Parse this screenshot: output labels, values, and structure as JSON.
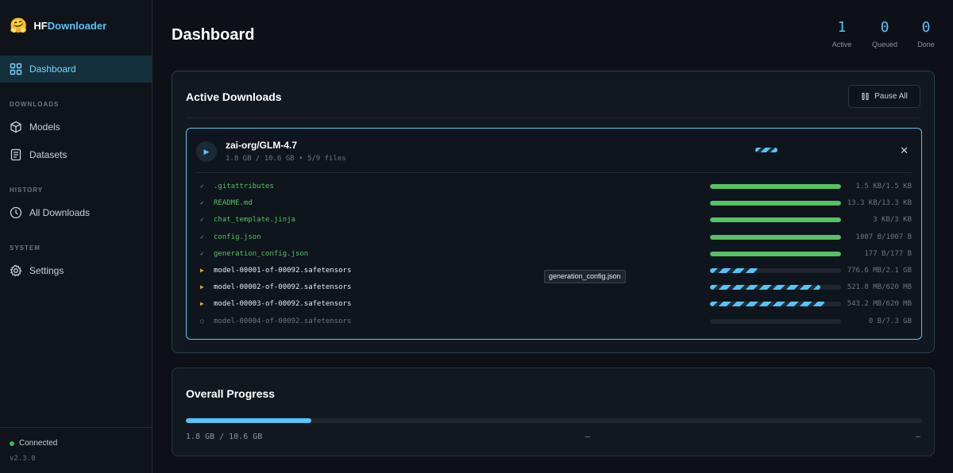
{
  "app": {
    "brand_emoji": "🤗",
    "brand_a": "HF",
    "brand_b": "Downloader"
  },
  "sidebar": {
    "dashboard": "Dashboard",
    "downloads_label": "DOWNLOADS",
    "models": "Models",
    "datasets": "Datasets",
    "history_label": "HISTORY",
    "all_downloads": "All Downloads",
    "system_label": "SYSTEM",
    "settings": "Settings",
    "status": "Connected",
    "version": "v2.3.0"
  },
  "header": {
    "title": "Dashboard",
    "stats": [
      {
        "value": "1",
        "label": "Active"
      },
      {
        "value": "0",
        "label": "Queued"
      },
      {
        "value": "0",
        "label": "Done"
      }
    ]
  },
  "active": {
    "title": "Active Downloads",
    "pause_all": "Pause All",
    "repo": "zai-org/GLM-4.7",
    "meta": "1.8 GB / 10.6 GB • 5/9 files",
    "files": [
      {
        "name": ".gitattributes",
        "status": "done",
        "progress": 1.0,
        "size": "1.5 KB/1.5 KB",
        "icon": "✓"
      },
      {
        "name": "README.md",
        "status": "done",
        "progress": 1.0,
        "size": "13.3 KB/13.3 KB",
        "icon": "✓"
      },
      {
        "name": "chat_template.jinja",
        "status": "done",
        "progress": 1.0,
        "size": "3 KB/3 KB",
        "icon": "✓"
      },
      {
        "name": "config.json",
        "status": "done",
        "progress": 1.0,
        "size": "1007 B/1007 B",
        "icon": "✓"
      },
      {
        "name": "generation_config.json",
        "status": "done",
        "progress": 1.0,
        "size": "177 B/177 B",
        "icon": "✓"
      },
      {
        "name": "model-00001-of-00092.safetensors",
        "status": "running",
        "progress": 0.37,
        "size": "776.6 MB/2.1 GB",
        "icon": "▶"
      },
      {
        "name": "model-00002-of-00092.safetensors",
        "status": "running",
        "progress": 0.84,
        "size": "521.8 MB/620 MB",
        "icon": "▶"
      },
      {
        "name": "model-00003-of-00092.safetensors",
        "status": "running",
        "progress": 0.88,
        "size": "543.2 MB/620 MB",
        "icon": "▶"
      },
      {
        "name": "model-00004-of-00092.safetensors",
        "status": "pending",
        "progress": 0.0,
        "size": "0 B/7.3 GB",
        "icon": "○"
      }
    ],
    "tooltip": "generation_config.json"
  },
  "overall": {
    "title": "Overall Progress",
    "progress": 0.17,
    "text": "1.8 GB / 10.6 GB",
    "speed": "—",
    "eta": "—"
  },
  "colors": {
    "accent": "#58c4f6",
    "success": "#56c167",
    "warning": "#e3a13b"
  }
}
